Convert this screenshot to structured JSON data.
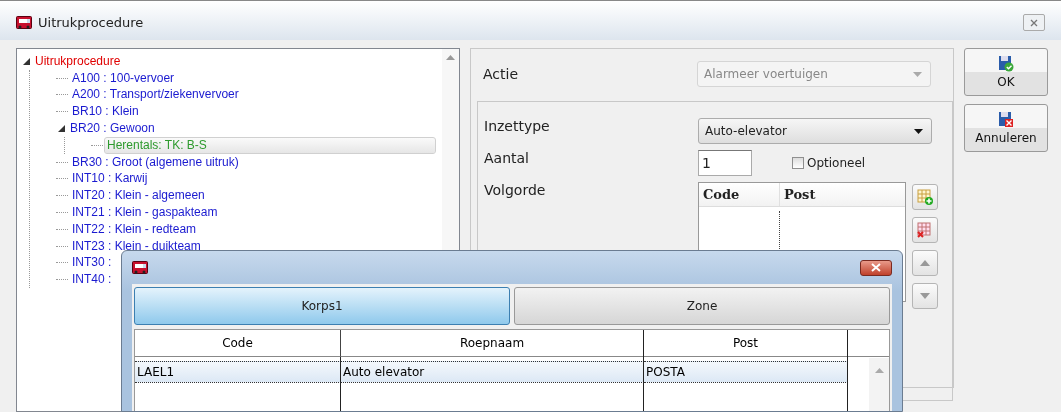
{
  "window": {
    "title": "Uitrukprocedure"
  },
  "tree": {
    "root": {
      "label": "Uitrukprocedure",
      "kind": "root",
      "selected": false,
      "expanded": true,
      "children": [
        {
          "label": "A100 : 100-vervoer",
          "kind": "procedure",
          "selected": false
        },
        {
          "label": "A200 : Transport/ziekenvervoer",
          "kind": "procedure",
          "selected": false
        },
        {
          "label": "BR10 : Klein",
          "kind": "procedure",
          "selected": false
        },
        {
          "label": "BR20 : Gewoon",
          "kind": "procedure",
          "selected": false,
          "expanded": true,
          "children": [
            {
              "label": "Herentals: TK: B-S",
              "kind": "unit",
              "selected": true
            }
          ]
        },
        {
          "label": "BR30 : Groot (algemene uitruk)",
          "kind": "procedure",
          "selected": false
        },
        {
          "label": "INT10 : Karwij",
          "kind": "procedure",
          "selected": false
        },
        {
          "label": "INT20 : Klein - algemeen",
          "kind": "procedure",
          "selected": false
        },
        {
          "label": "INT21 : Klein - gaspakteam",
          "kind": "procedure",
          "selected": false
        },
        {
          "label": "INT22 : Klein - redteam",
          "kind": "procedure",
          "selected": false
        },
        {
          "label": "INT23 : Klein - duikteam",
          "kind": "procedure",
          "selected": false
        },
        {
          "label": "INT30 :",
          "kind": "procedure",
          "selected": false
        },
        {
          "label": "INT40 :",
          "kind": "procedure",
          "selected": false
        }
      ]
    }
  },
  "form": {
    "actie": {
      "label": "Actie",
      "value": "Alarmeer voertuigen",
      "disabled": true
    },
    "inzettype": {
      "label": "Inzettype",
      "value": "Auto-elevator",
      "disabled": false
    },
    "aantal": {
      "label": "Aantal",
      "value": "1"
    },
    "optioneel": {
      "label": "Optioneel",
      "checked": false
    },
    "volgorde": {
      "label": "Volgorde",
      "columns": [
        "Code",
        "Post"
      ]
    }
  },
  "buttons": [
    {
      "label": "OK",
      "kind": "ok"
    },
    {
      "label": "Annuleren",
      "kind": "cancel"
    }
  ],
  "dialog": {
    "tabs": [
      {
        "label": "Korps1",
        "selected": true
      },
      {
        "label": "Zone",
        "selected": false
      }
    ],
    "columns": [
      "Code",
      "Roepnaam",
      "Post"
    ],
    "rows": [
      {
        "cells": [
          "LAEL1",
          "Auto elevator",
          "POSTA"
        ],
        "selected": true
      }
    ]
  }
}
